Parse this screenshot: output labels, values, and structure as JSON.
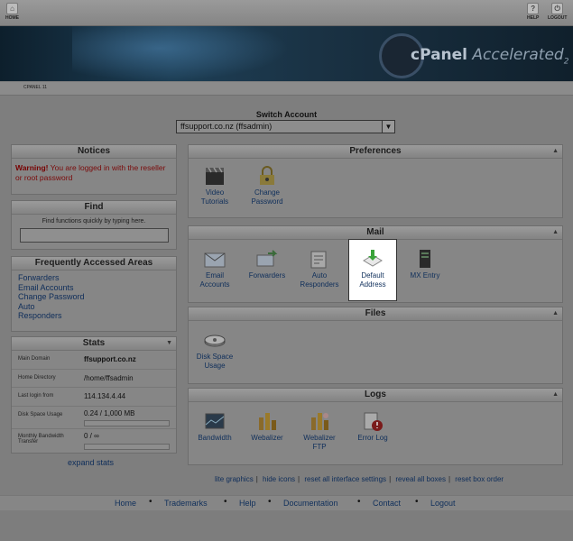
{
  "topbar": {
    "home": "HOME",
    "help": "HELP",
    "logout": "LOGOUT"
  },
  "banner": {
    "logo": "cPanel",
    "logo_suffix": "Accelerated",
    "logo_sub": "2"
  },
  "crumb": "CPANEL 11",
  "switch": {
    "label": "Switch Account",
    "value": "ffsupport.co.nz (ffsadmin)"
  },
  "notices": {
    "title": "Notices",
    "warning_bold": "Warning!",
    "warning_text": " You are logged in with the reseller or root password"
  },
  "find": {
    "title": "Find",
    "hint": "Find functions quickly by typing here."
  },
  "faa": {
    "title": "Frequently Accessed Areas",
    "items": [
      "Forwarders",
      "Email Accounts",
      "Change Password",
      "Auto",
      "Responders"
    ]
  },
  "stats": {
    "title": "Stats",
    "rows": [
      {
        "k": "Main Domain",
        "v": "ffsupport.co.nz"
      },
      {
        "k": "Home Directory",
        "v": "/home/ffsadmin"
      },
      {
        "k": "Last login from",
        "v": "114.134.4.44"
      },
      {
        "k": "Disk Space Usage",
        "v": "0.24 / 1,000 MB"
      },
      {
        "k": "Monthly Bandwidth Transfer",
        "v": "0 / ∞"
      }
    ],
    "expand": "expand stats"
  },
  "preferences": {
    "title": "Preferences",
    "items": [
      {
        "l1": "Video",
        "l2": "Tutorials"
      },
      {
        "l1": "Change",
        "l2": "Password"
      }
    ]
  },
  "mail": {
    "title": "Mail",
    "items": [
      {
        "l1": "Email",
        "l2": "Accounts"
      },
      {
        "l1": "Forwarders",
        "l2": ""
      },
      {
        "l1": "Auto",
        "l2": "Responders"
      },
      {
        "l1": "Default",
        "l2": "Address"
      },
      {
        "l1": "MX Entry",
        "l2": ""
      }
    ]
  },
  "files": {
    "title": "Files",
    "items": [
      {
        "l1": "Disk Space",
        "l2": "Usage"
      }
    ]
  },
  "logs": {
    "title": "Logs",
    "items": [
      {
        "l1": "Bandwidth",
        "l2": ""
      },
      {
        "l1": "Webalizer",
        "l2": ""
      },
      {
        "l1": "Webalizer",
        "l2": "FTP"
      },
      {
        "l1": "Error Log",
        "l2": ""
      }
    ]
  },
  "links": [
    "lite graphics",
    "hide icons",
    "reset all interface settings",
    "reveal all boxes",
    "reset box order"
  ],
  "footer": [
    "Home",
    "Trademarks",
    "Help",
    "Documentation",
    "Contact",
    "Logout"
  ]
}
